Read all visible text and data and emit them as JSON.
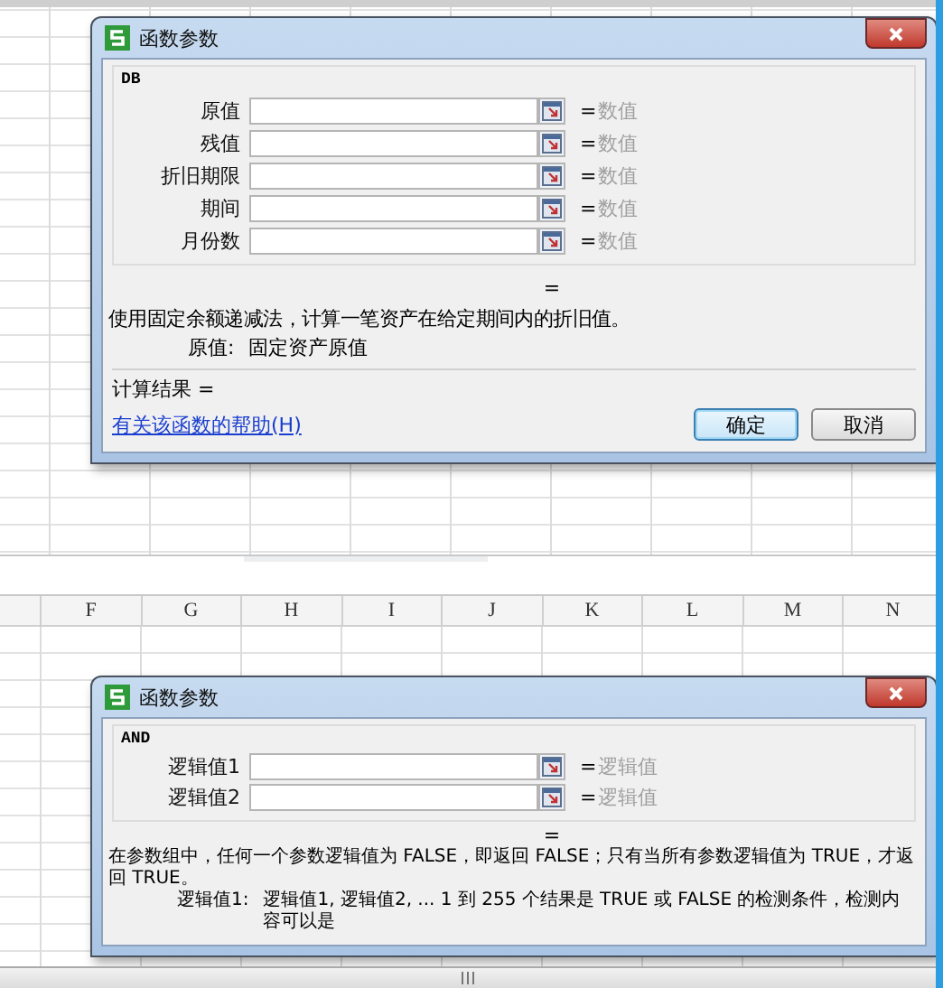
{
  "top_pane": {
    "dialog": {
      "title": "函数参数",
      "function_name": "DB",
      "arguments": [
        {
          "label": "原值",
          "equals": "=",
          "result_hint": "数值"
        },
        {
          "label": "残值",
          "equals": "=",
          "result_hint": "数值"
        },
        {
          "label": "折旧期限",
          "equals": "=",
          "result_hint": "数值"
        },
        {
          "label": "期间",
          "equals": "=",
          "result_hint": "数值"
        },
        {
          "label": "月份数",
          "equals": "=",
          "result_hint": "数值"
        }
      ],
      "formula_equals": "=",
      "description": "使用固定余额递减法，计算一笔资产在给定期间内的折旧值。",
      "argument_help": {
        "label": "原值:",
        "text": "固定资产原值"
      },
      "result_label": "计算结果 =",
      "help_link": "有关该函数的帮助(H)",
      "buttons": [
        {
          "label": "确定",
          "default": true
        },
        {
          "label": "取消",
          "default": false
        }
      ]
    }
  },
  "bottom_pane": {
    "column_headers": [
      "F",
      "G",
      "H",
      "I",
      "J",
      "K",
      "L",
      "M",
      "N"
    ],
    "dialog": {
      "title": "函数参数",
      "function_name": "AND",
      "arguments": [
        {
          "label": "逻辑值1",
          "equals": "=",
          "result_hint": "逻辑值"
        },
        {
          "label": "逻辑值2",
          "equals": "=",
          "result_hint": "逻辑值"
        }
      ],
      "formula_equals": "=",
      "description": "在参数组中，任何一个参数逻辑值为 FALSE，即返回 FALSE；只有当所有参数逻辑值为 TRUE，才返回 TRUE。",
      "argument_help": {
        "label": "逻辑值1:",
        "text": "逻辑值1, 逻辑值2, ... 1 到 255 个结果是 TRUE 或 FALSE 的检测条件，检测内容可以是"
      }
    }
  }
}
